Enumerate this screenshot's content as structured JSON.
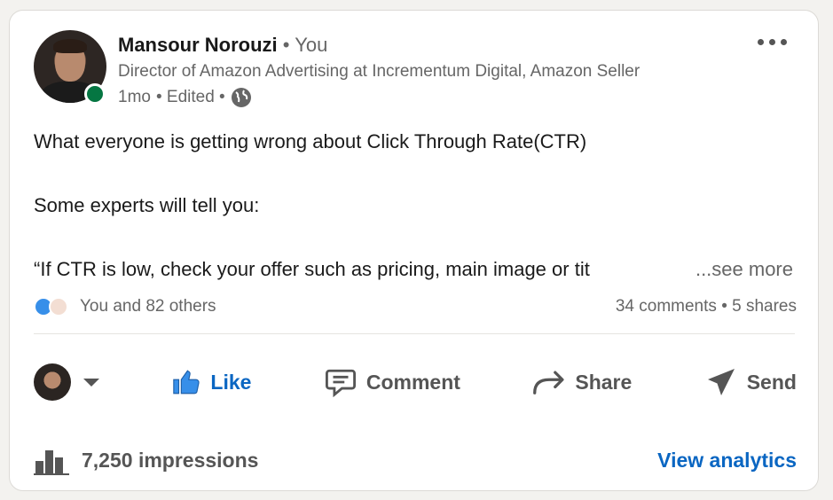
{
  "author": {
    "name": "Mansour Norouzi",
    "relation": "• You",
    "headline": "Director of Amazon Advertising at Incrementum Digital, Amazon Seller",
    "age": "1mo",
    "edited": "• Edited •",
    "visibility_icon": "globe-icon"
  },
  "post": {
    "line1": "What everyone is getting wrong about Click Through Rate(CTR)",
    "line2": "Some experts will tell you:",
    "line3": "“If CTR is low, check your offer such as pricing, main image or tit",
    "see_more": "...see more"
  },
  "social": {
    "reactions": "You and 82 others",
    "comments": "34 comments",
    "separator": "•",
    "shares": "5 shares"
  },
  "actions": {
    "like": "Like",
    "comment": "Comment",
    "share": "Share",
    "send": "Send"
  },
  "footer": {
    "impressions": "7,250 impressions",
    "analytics": "View analytics"
  },
  "colors": {
    "accent": "#0a66c2",
    "online": "#057642"
  }
}
